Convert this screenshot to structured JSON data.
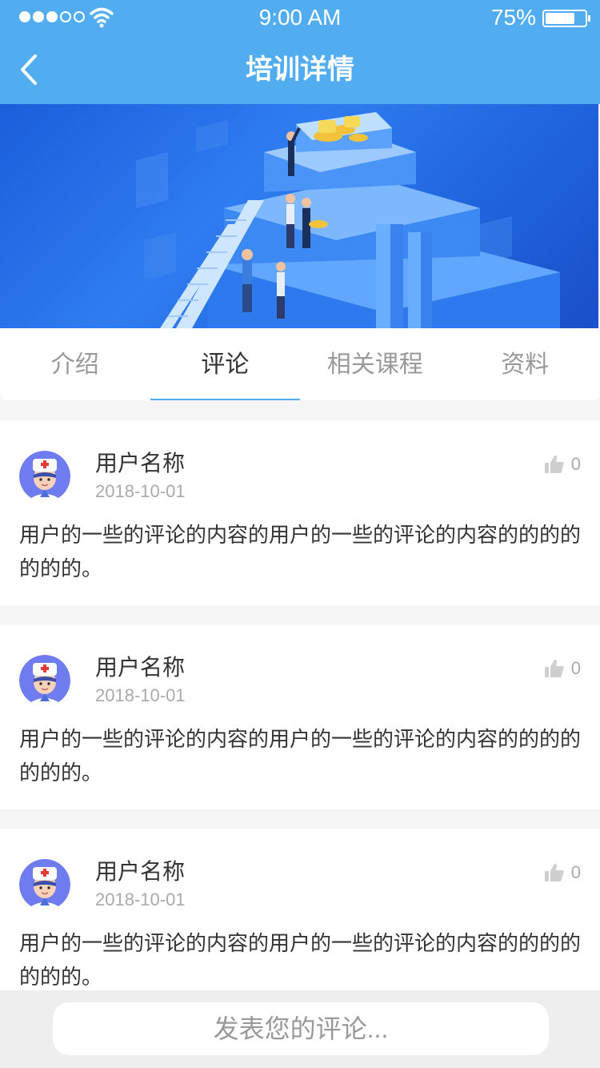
{
  "status_bar": {
    "time": "9:00 AM",
    "battery_percent": "75%",
    "battery_level": 0.75,
    "signal_bars": 3,
    "signal_total": 5
  },
  "nav": {
    "title": "培训详情",
    "back_icon": "chevron-left-icon"
  },
  "banner": {
    "image": "isometric-training-illustration"
  },
  "tabs": [
    {
      "label": "介绍",
      "active": false
    },
    {
      "label": "评论",
      "active": true
    },
    {
      "label": "相关课程",
      "active": false
    },
    {
      "label": "资料",
      "active": false
    }
  ],
  "comments": [
    {
      "username": "用户名称",
      "date": "2018-10-01",
      "likes": "0",
      "content": "用户的一些的评论的内容的用户的一些的评论的内容的的的的的的的。"
    },
    {
      "username": "用户名称",
      "date": "2018-10-01",
      "likes": "0",
      "content": "用户的一些的评论的内容的用户的一些的评论的内容的的的的的的的。"
    },
    {
      "username": "用户名称",
      "date": "2018-10-01",
      "likes": "0",
      "content": "用户的一些的评论的内容的用户的一些的评论的内容的的的的的的的。"
    }
  ],
  "input": {
    "placeholder": "发表您的评论..."
  },
  "colors": {
    "primary": "#52adf0",
    "background": "#f5f5f5",
    "text": "#333333",
    "muted": "#aaaaaa"
  }
}
